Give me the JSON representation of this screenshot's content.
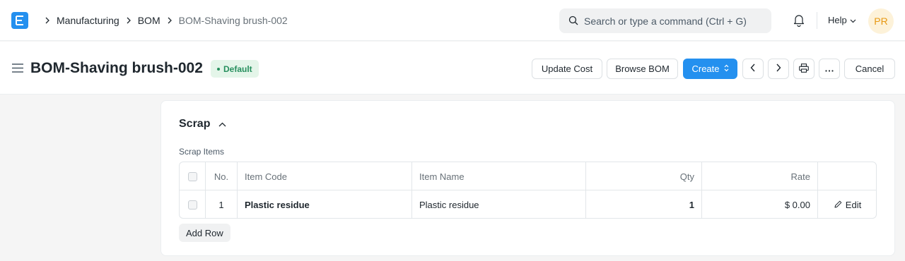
{
  "navbar": {
    "breadcrumbs": [
      "Manufacturing",
      "BOM",
      "BOM-Shaving brush-002"
    ],
    "search_placeholder": "Search or type a command (Ctrl + G)",
    "help_label": "Help",
    "avatar_initials": "PR"
  },
  "page": {
    "title": "BOM-Shaving brush-002",
    "status_badge": "Default",
    "buttons": {
      "update_cost": "Update Cost",
      "browse_bom": "Browse BOM",
      "create": "Create",
      "cancel": "Cancel"
    }
  },
  "section": {
    "title": "Scrap",
    "table_label": "Scrap Items",
    "columns": {
      "no": "No.",
      "item_code": "Item Code",
      "item_name": "Item Name",
      "qty": "Qty",
      "rate": "Rate"
    },
    "rows": [
      {
        "no": "1",
        "item_code": "Plastic residue",
        "item_name": "Plastic residue",
        "qty": "1",
        "rate": "$ 0.00",
        "edit_label": "Edit"
      }
    ],
    "add_row_label": "Add Row"
  },
  "colors": {
    "primary": "#2490ef",
    "badge_green": "#278f5e",
    "avatar_bg": "#fdf2d9",
    "avatar_text": "#e79913"
  },
  "icons": {
    "logo": "erpnext-logo-icon",
    "search": "search-icon",
    "notifications": "bell-icon",
    "menu": "hamburger-icon",
    "collapse": "chevron-up-icon",
    "print": "printer-icon",
    "more": "ellipsis-icon",
    "edit": "pencil-icon"
  }
}
